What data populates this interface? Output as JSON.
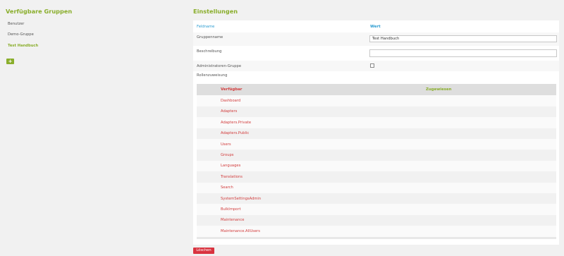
{
  "left": {
    "title": "Verfügbare Gruppen",
    "groups": [
      "Benutzer",
      "Demo-Gruppe",
      "Test Handbuch"
    ],
    "active_group": "Test Handbuch",
    "add_label": "+"
  },
  "right": {
    "title": "Einstellungen",
    "header_field": "Feldname",
    "header_value": "Wert",
    "group_name_label": "Gruppenname",
    "group_name_value": "Test Handbuch",
    "description_label": "Beschreibung",
    "description_value": "",
    "admin_label": "Administratoren-Gruppe",
    "admin_checked": false,
    "roles_label": "Rollenzuweisung",
    "roles_available_header": "Verfügbar",
    "roles_assigned_header": "Zugewiesen",
    "roles": [
      "Dashboard",
      "Adapters",
      "Adapters.Private",
      "Adapters.Public",
      "Users",
      "Groups",
      "Languages",
      "Translations",
      "Search",
      "SystemSettingsAdmin",
      "BulkImport",
      "Maintenance",
      "Maintenance.AllUsers"
    ],
    "delete_label": "Löschen"
  },
  "colors": {
    "accent_green": "#8aae2c",
    "link_red": "#d23c3c",
    "header_blue": "#2a9bd0",
    "delete_red": "#d9333f"
  }
}
